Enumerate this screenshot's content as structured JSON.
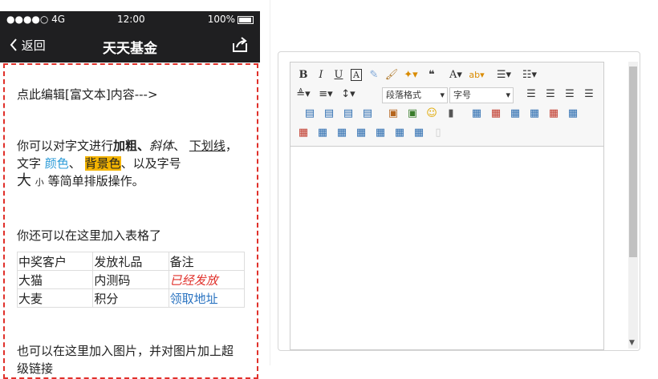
{
  "status": {
    "signal": "●●●●○ 4G",
    "time": "12:00",
    "battery": "100%"
  },
  "nav": {
    "back": "返回",
    "title": "天天基金"
  },
  "content": {
    "line1": "点此编辑[富文本]内容--->",
    "para_prefix": "你可以对字文进行",
    "bold": "加粗",
    "sep1": "、",
    "italic": "斜体",
    "sep2": "、 ",
    "underline": "下划线",
    "sep3": "，文字 ",
    "color": "颜色",
    "sep4": "、 ",
    "bg": "背景色",
    "sep5": "、以及字号",
    "big": "大",
    "small": "小",
    "tail": "等简单排版操作。",
    "table_intro": "你还可以在这里加入表格了",
    "table": [
      [
        "中奖客户",
        "发放礼品",
        "备注"
      ],
      [
        "大猫",
        "内测码",
        "已经发放"
      ],
      [
        "大麦",
        "积分",
        "领取地址"
      ]
    ],
    "image_text": "也可以在这里加入图片，并对图片加上超级链接"
  },
  "toolbar": {
    "format_select": "段落格式",
    "size_select": "字号"
  },
  "colors": {
    "bar": "#1f1f21",
    "dash": "#e0302a",
    "link": "#2b74c1",
    "red_italic": "#e0302a",
    "highlight": "#f4b400"
  }
}
